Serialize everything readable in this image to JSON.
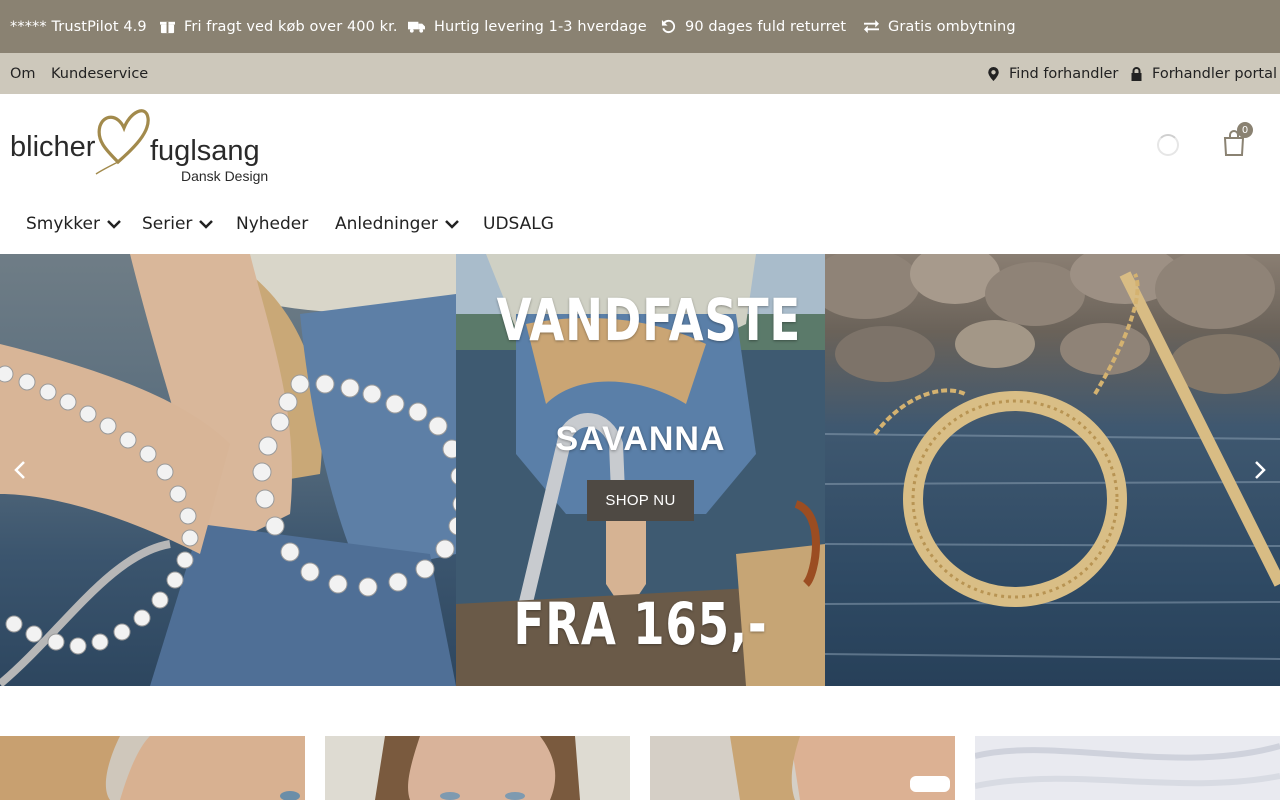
{
  "topbar": {
    "items": [
      {
        "label": "***** TrustPilot 4.9",
        "icon": "none"
      },
      {
        "label": "Fri fragt ved køb over 400 kr.",
        "icon": "gift-icon"
      },
      {
        "label": "Hurtig levering 1-3 hverdage",
        "icon": "truck-icon"
      },
      {
        "label": "90 dages fuld returret",
        "icon": "undo-icon"
      },
      {
        "label": "Gratis ombytning",
        "icon": "exchange-icon"
      }
    ],
    "bg": "#8a8272"
  },
  "subbar": {
    "left": [
      "Om",
      "Kundeservice"
    ],
    "right": [
      {
        "label": "Find forhandler",
        "icon": "map-marker-icon"
      },
      {
        "label": "Forhandler portal",
        "icon": "lock-icon"
      }
    ],
    "bg": "#cdc8bb"
  },
  "logo": {
    "text1": "blicher",
    "text2": "fuglsang",
    "tagline": "Dansk Design",
    "heart_color": "#a28a4c"
  },
  "cart": {
    "count": "0"
  },
  "nav": [
    {
      "label": "Smykker",
      "dropdown": true
    },
    {
      "label": "Serier",
      "dropdown": true
    },
    {
      "label": "Nyheder",
      "dropdown": false
    },
    {
      "label": "Anledninger",
      "dropdown": true
    },
    {
      "label": "UDSALG",
      "dropdown": false
    }
  ],
  "hero": {
    "headline_top": "VANDFASTE",
    "series": "SAVANNA",
    "button": "SHOP NU",
    "price": "FRA 165,-"
  }
}
